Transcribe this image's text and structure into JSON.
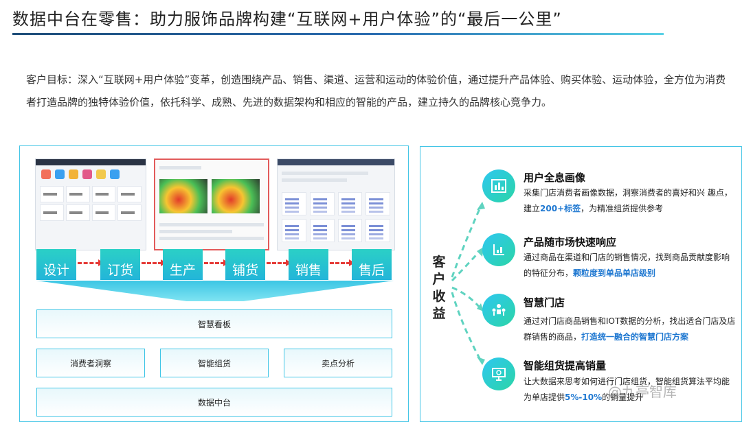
{
  "header": {
    "title": "数据中台在零售：助力服饰品牌构建“互联网+用户体验”的“最后一公里”"
  },
  "intro": {
    "text": "客户目标：深入“互联网+用户体验”变革，创造围绕产品、销售、渠道、运营和运动的体验价值，通过提升产品体验、购买体验、运动体验，全方位为消费者打造品牌的独特体验价值，依托科学、成熟、先进的数据架构和相应的智能的产品，建立持久的品牌核心竞争力。"
  },
  "left_panel": {
    "stages": [
      "设计",
      "订货",
      "生产",
      "铺货",
      "销售",
      "售后"
    ],
    "dashboard_label": "智慧看板",
    "modules": [
      "消费者洞察",
      "智能组货",
      "卖点分析"
    ],
    "platform_label": "数据中台"
  },
  "right_panel": {
    "side_label": "客户收益",
    "benefits": [
      {
        "icon": "bar-chart-icon",
        "title": "用户全息画像",
        "desc_plain": "采集门店消费者画像数据，洞察消费者的喜好和兴 趣点，建立",
        "desc_highlight": "200+标签",
        "desc_tail": "，为精准组货提供参考"
      },
      {
        "icon": "axis-chart-icon",
        "title": "产品随市场快速响应",
        "desc_plain": "通过商品在渠道和门店的销售情况，找到商品贡献度影响的特征分布，",
        "desc_highlight": "颗粒度到单品单店级别",
        "desc_tail": ""
      },
      {
        "icon": "store-network-icon",
        "title": "智慧门店",
        "desc_plain": "通过对门店商品销售和IOT数据的分析，找出适合门店及店群销售的商品，",
        "desc_highlight": "打造统一融合的智慧门店方案",
        "desc_tail": ""
      },
      {
        "icon": "presentation-icon",
        "title": "智能组货提高销量",
        "desc_plain": "让大数据来思考如何进行门店组货，智能组货算法平均能为单店提供",
        "desc_highlight": "5%-10%",
        "desc_tail": "的销量提升"
      }
    ]
  },
  "watermark": {
    "text": "@九亭智库"
  },
  "colors": {
    "accent_cyan": "#43c5e6",
    "accent_teal": "#2bd5a7",
    "arrow_red": "#e53935",
    "highlight_blue": "#1f78d1",
    "title_underline": "#1f4e79"
  }
}
